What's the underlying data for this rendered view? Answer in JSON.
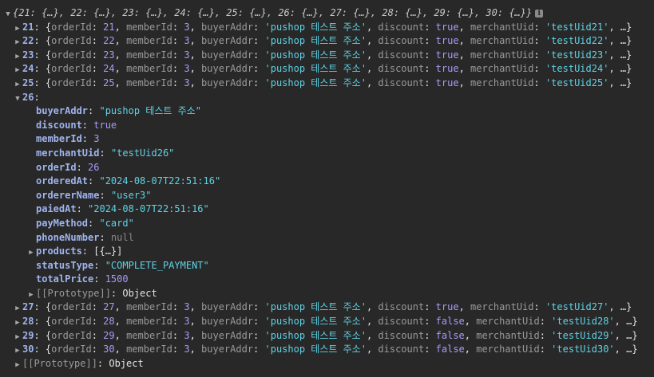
{
  "root": {
    "summary": "{21: {…}, 22: {…}, 23: {…}, 24: {…}, 25: {…}, 26: {…}, 27: {…}, 28: {…}, 29: {…}, 30: {…}}",
    "info_icon": "i"
  },
  "rows": [
    {
      "key": "21",
      "orderId": "21",
      "memberId": "3",
      "buyerAddr": "'pushop 테스트 주소'",
      "discount": "true",
      "merchantUid": "'testUid21'"
    },
    {
      "key": "22",
      "orderId": "22",
      "memberId": "3",
      "buyerAddr": "'pushop 테스트 주소'",
      "discount": "true",
      "merchantUid": "'testUid22'"
    },
    {
      "key": "23",
      "orderId": "23",
      "memberId": "3",
      "buyerAddr": "'pushop 테스트 주소'",
      "discount": "true",
      "merchantUid": "'testUid23'"
    },
    {
      "key": "24",
      "orderId": "24",
      "memberId": "3",
      "buyerAddr": "'pushop 테스트 주소'",
      "discount": "true",
      "merchantUid": "'testUid24'"
    },
    {
      "key": "25",
      "orderId": "25",
      "memberId": "3",
      "buyerAddr": "'pushop 테스트 주소'",
      "discount": "true",
      "merchantUid": "'testUid25'"
    },
    {
      "key": "27",
      "orderId": "27",
      "memberId": "3",
      "buyerAddr": "'pushop 테스트 주소'",
      "discount": "true",
      "merchantUid": "'testUid27'"
    },
    {
      "key": "28",
      "orderId": "28",
      "memberId": "3",
      "buyerAddr": "'pushop 테스트 주소'",
      "discount": "false",
      "merchantUid": "'testUid28'"
    },
    {
      "key": "29",
      "orderId": "29",
      "memberId": "3",
      "buyerAddr": "'pushop 테스트 주소'",
      "discount": "false",
      "merchantUid": "'testUid29'"
    },
    {
      "key": "30",
      "orderId": "30",
      "memberId": "3",
      "buyerAddr": "'pushop 테스트 주소'",
      "discount": "false",
      "merchantUid": "'testUid30'"
    }
  ],
  "labels": {
    "orderId": "orderId",
    "memberId": "memberId",
    "buyerAddr": "buyerAddr",
    "discount": "discount",
    "merchantUid": "merchantUid",
    "ellipsis": "…}"
  },
  "expanded": {
    "key": "26",
    "fields": [
      {
        "name": "buyerAddr",
        "value": "\"pushop 테스트 주소\"",
        "type": "string"
      },
      {
        "name": "discount",
        "value": "true",
        "type": "bool"
      },
      {
        "name": "memberId",
        "value": "3",
        "type": "number"
      },
      {
        "name": "merchantUid",
        "value": "\"testUid26\"",
        "type": "string"
      },
      {
        "name": "orderId",
        "value": "26",
        "type": "number"
      },
      {
        "name": "orderedAt",
        "value": "\"2024-08-07T22:51:16\"",
        "type": "string"
      },
      {
        "name": "ordererName",
        "value": "\"user3\"",
        "type": "string"
      },
      {
        "name": "paiedAt",
        "value": "\"2024-08-07T22:51:16\"",
        "type": "string"
      },
      {
        "name": "payMethod",
        "value": "\"card\"",
        "type": "string"
      },
      {
        "name": "phoneNumber",
        "value": "null",
        "type": "null"
      }
    ],
    "products": {
      "name": "products",
      "value": "[{…}]"
    },
    "fields_after": [
      {
        "name": "statusType",
        "value": "\"COMPLETE_PAYMENT\"",
        "type": "string"
      },
      {
        "name": "totalPrice",
        "value": "1500",
        "type": "number"
      }
    ],
    "prototype": {
      "name": "[[Prototype]]",
      "value": "Object"
    }
  },
  "root_prototype": {
    "name": "[[Prototype]]",
    "value": "Object"
  },
  "icons": {
    "expanded": "▼",
    "collapsed": "▶"
  }
}
